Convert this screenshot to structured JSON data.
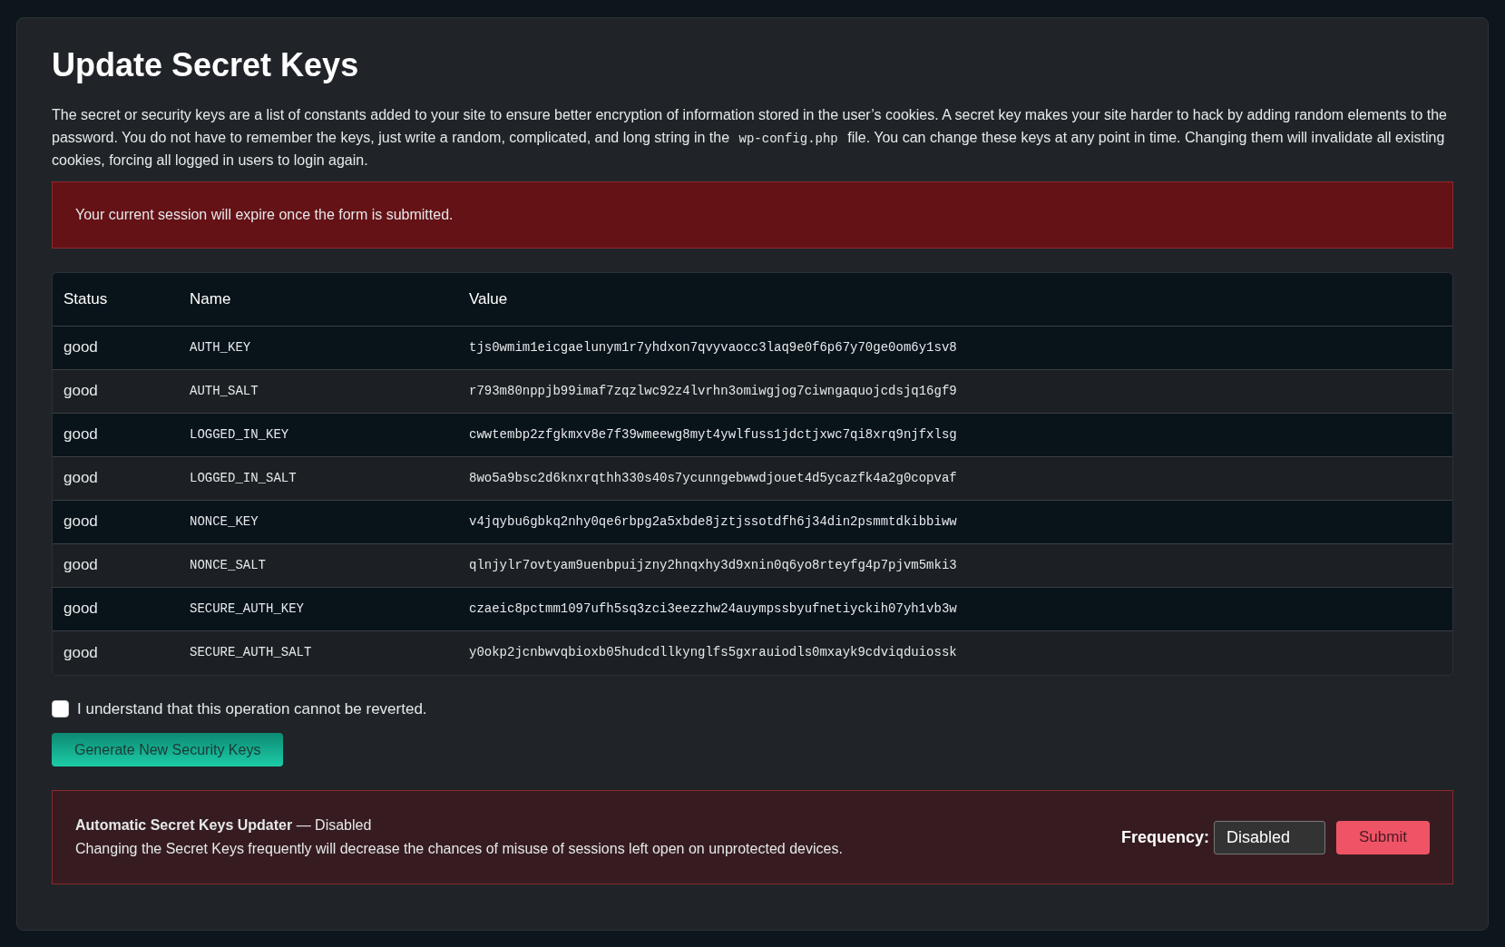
{
  "title": "Update Secret Keys",
  "description": {
    "before": "The secret or security keys are a list of constants added to your site to ensure better encryption of information stored in the user’s cookies. A secret key makes your site harder to hack by adding random elements to the password. You do not have to remember the keys, just write a random, complicated, and long string in the",
    "code": "wp-config.php",
    "after": "file. You can change these keys at any point in time. Changing them will invalidate all existing cookies, forcing all logged in users to login again."
  },
  "alert": "Your current session will expire once the form is submitted.",
  "table": {
    "columns": [
      "Status",
      "Name",
      "Value"
    ],
    "rows": [
      {
        "status": "good",
        "name": "AUTH_KEY",
        "value": "tjs0wmim1eicgaelunym1r7yhdxon7qvyvaocc3laq9e0f6p67y70ge0om6y1sv8"
      },
      {
        "status": "good",
        "name": "AUTH_SALT",
        "value": "r793m80nppjb99imaf7zqzlwc92z4lvrhn3omiwgjog7ciwngaquojcdsjq16gf9"
      },
      {
        "status": "good",
        "name": "LOGGED_IN_KEY",
        "value": "cwwtembp2zfgkmxv8e7f39wmeewg8myt4ywlfuss1jdctjxwc7qi8xrq9njfxlsg"
      },
      {
        "status": "good",
        "name": "LOGGED_IN_SALT",
        "value": "8wo5a9bsc2d6knxrqthh330s40s7ycunngebwwdjouet4d5ycazfk4a2g0copvaf"
      },
      {
        "status": "good",
        "name": "NONCE_KEY",
        "value": "v4jqybu6gbkq2nhy0qe6rbpg2a5xbde8jztjssotdfh6j34din2psmmtdkibbiww"
      },
      {
        "status": "good",
        "name": "NONCE_SALT",
        "value": "qlnjylr7ovtyam9uenbpuijzny2hnqxhy3d9xnin0q6yo8rteyfg4p7pjvm5mki3"
      },
      {
        "status": "good",
        "name": "SECURE_AUTH_KEY",
        "value": "czaeic8pctmm1097ufh5sq3zci3eezzhw24auympssbyufnetiyckih07yh1vb3w"
      },
      {
        "status": "good",
        "name": "SECURE_AUTH_SALT",
        "value": "y0okp2jcnbwvqbioxb05hudcdllkynglfs5gxrauiodls0mxayk9cdviqduiossk"
      }
    ]
  },
  "confirm": {
    "label": "I understand that this operation cannot be reverted.",
    "checked": false
  },
  "generate_button": "Generate New Security Keys",
  "updater": {
    "heading": "**Automatic Secret Keys Updater** — Disabled",
    "text": "Changing the Secret Keys frequently will decrease the chances of misuse of sessions left open on unprotected devices.",
    "frequency_label": "Frequency:",
    "frequency_value": "Disabled",
    "submit": "Submit"
  }
}
